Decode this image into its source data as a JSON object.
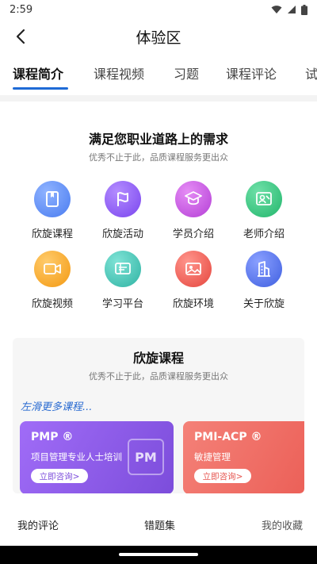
{
  "status": {
    "time": "2:59"
  },
  "header": {
    "title": "体验区"
  },
  "tabs": [
    {
      "label": "课程简介",
      "active": true
    },
    {
      "label": "课程视频"
    },
    {
      "label": "习题"
    },
    {
      "label": "课程评论"
    },
    {
      "label": "试"
    }
  ],
  "needs": {
    "title": "满足您职业道路上的需求",
    "subtitle": "优秀不止于此，品质课程服务更出众",
    "items": [
      {
        "label": "欣旋课程",
        "icon": "book-icon",
        "color": "#5b8ef5"
      },
      {
        "label": "欣旋活动",
        "icon": "flag-icon",
        "color": "#8a5cf5"
      },
      {
        "label": "学员介绍",
        "icon": "graduation-cap-icon",
        "color": "#c64de0"
      },
      {
        "label": "老师介绍",
        "icon": "teacher-board-icon",
        "color": "#2fc27c"
      },
      {
        "label": "欣旋视频",
        "icon": "video-icon",
        "color": "#f6a21b"
      },
      {
        "label": "学习平台",
        "icon": "platform-icon",
        "color": "#3bbfb0"
      },
      {
        "label": "欣旋环境",
        "icon": "image-icon",
        "color": "#ec5e55"
      },
      {
        "label": "关于欣旋",
        "icon": "building-icon",
        "color": "#4f6ee8"
      }
    ]
  },
  "courses": {
    "title": "欣旋课程",
    "subtitle": "优秀不止于此，品质课程服务更出众",
    "hint": "左滑更多课程...",
    "cards": [
      {
        "title": "PMP ®",
        "desc": "项目管理专业人士培训",
        "button": "立即咨询>",
        "badge": "PM",
        "color": "#8b5cf6",
        "button_color": "#7c4ddb"
      },
      {
        "title": "PMI-ACP ®",
        "desc": "敏捷管理",
        "button": "立即咨询>",
        "color": "#f0706a",
        "button_color": "#e6544e"
      }
    ]
  },
  "bottom": {
    "items": [
      "我的评论",
      "错题集",
      "我的收藏"
    ]
  }
}
